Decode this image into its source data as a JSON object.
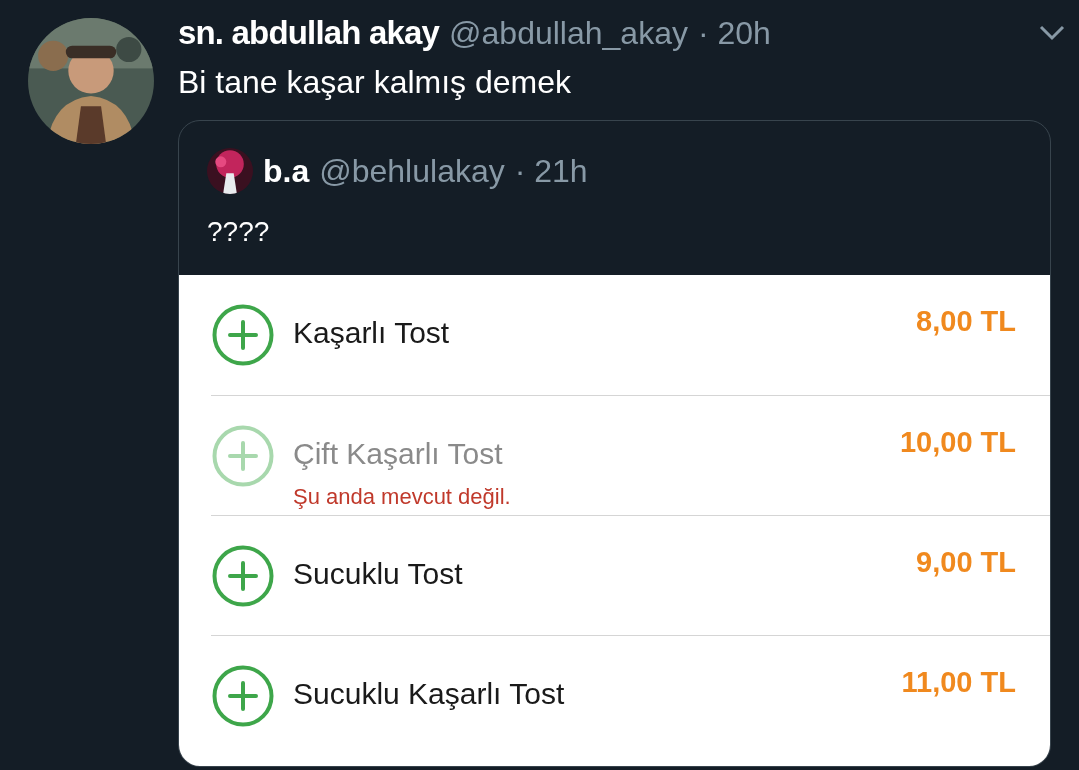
{
  "tweet": {
    "name": "sn. abdullah akay",
    "handle": "@abdullah_akay",
    "time": "· 20h",
    "text": "Bi tane kaşar kalmış demek"
  },
  "quote": {
    "name": "b.a",
    "handle": "@behlulakay",
    "time": "· 21h",
    "text": "????"
  },
  "menu_items": [
    {
      "name": "Kaşarlı Tost",
      "price": "8,00 TL",
      "available": true
    },
    {
      "name": "Çift Kaşarlı Tost",
      "price": "10,00 TL",
      "available": false,
      "note": "Şu anda mevcut değil."
    },
    {
      "name": "Sucuklu Tost",
      "price": "9,00 TL",
      "available": true
    },
    {
      "name": "Sucuklu Kaşarlı Tost",
      "price": "11,00 TL",
      "available": true
    }
  ]
}
